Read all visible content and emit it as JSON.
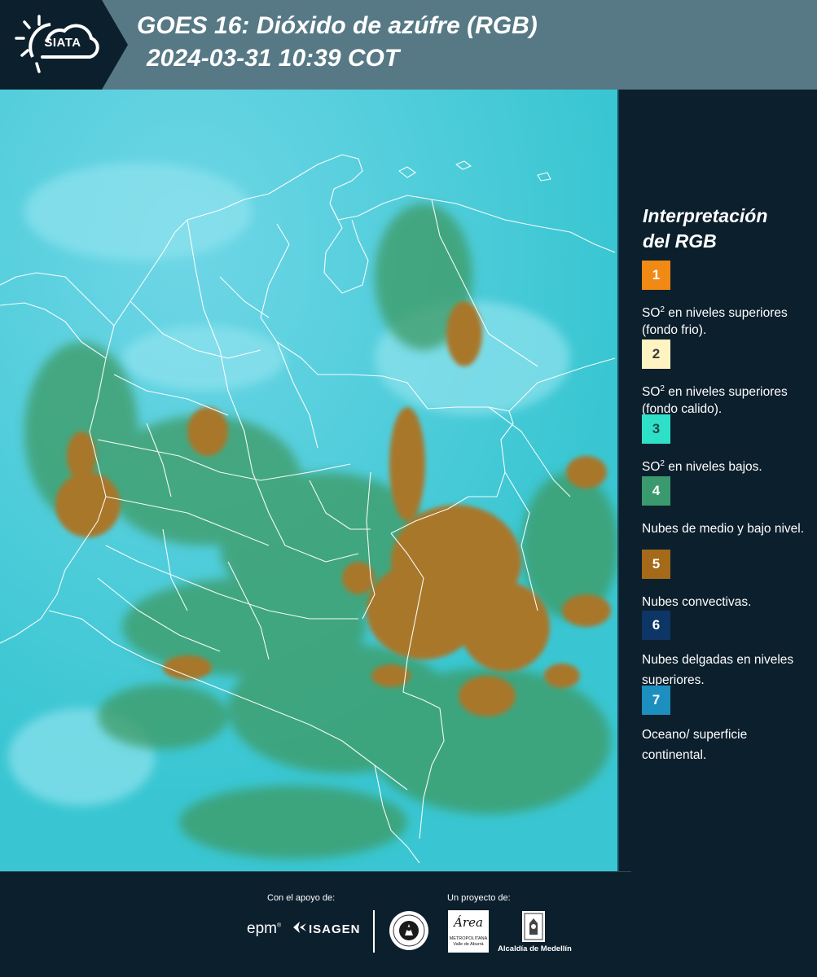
{
  "header": {
    "logo_text": "SIATA",
    "title_line1": "GOES 16: Dióxido de azúfre (RGB)",
    "title_line2": "2024-03-31 10:39 COT",
    "background": "#567985",
    "logo_background": "#0c1f2d"
  },
  "map": {
    "description_icon": "satellite-rgb-map",
    "colors": {
      "background": "#3cc9d8",
      "convective": "#a8772b",
      "low_cloud": "#3d9a63",
      "borders": "#ffffff"
    }
  },
  "legend": {
    "title_line1": "Interpretación",
    "title_line2": "del RGB",
    "items": [
      {
        "number": "1",
        "color": "#f08a14",
        "text_color": "#ffffff",
        "desc_pre": "SO",
        "desc_sup": "2",
        "desc_post": " en niveles superiores (fondo frio)."
      },
      {
        "number": "2",
        "color": "#fff3c2",
        "text_color": "#3a3a3a",
        "desc_pre": "SO",
        "desc_sup": "2",
        "desc_post": " en niveles superiores (fondo calido)."
      },
      {
        "number": "3",
        "color": "#2fe0c8",
        "text_color": "#1d4a4a",
        "desc_pre": "SO",
        "desc_sup": "2",
        "desc_post": " en niveles bajos."
      },
      {
        "number": "4",
        "color": "#3a9a6e",
        "text_color": "#ffffff",
        "desc_pre": "Nubes de medio y bajo nivel.",
        "desc_sup": "",
        "desc_post": ""
      },
      {
        "number": "5",
        "color": "#a5691a",
        "text_color": "#ffffff",
        "desc_pre": "Nubes convectivas.",
        "desc_sup": "",
        "desc_post": ""
      },
      {
        "number": "6",
        "color": "#0d3566",
        "text_color": "#ffffff",
        "desc_pre": "Nubes delgadas en niveles superiores.",
        "desc_sup": "",
        "desc_post": ""
      },
      {
        "number": "7",
        "color": "#1c8fbe",
        "text_color": "#ffffff",
        "desc_pre": "Oceano/ superficie continental.",
        "desc_sup": "",
        "desc_post": ""
      }
    ]
  },
  "footer": {
    "support_label": "Con el apoyo de:",
    "project_label": "Un proyecto de:",
    "epm_text": "epm",
    "epm_reg": "®",
    "isagen_text": "ISAGEN",
    "area_text": "Área",
    "area_sub_line1": "METROPOLITANA",
    "area_sub_line2": "Valle de Aburrá",
    "alcaldia_text": "Alcaldía de Medellín"
  }
}
